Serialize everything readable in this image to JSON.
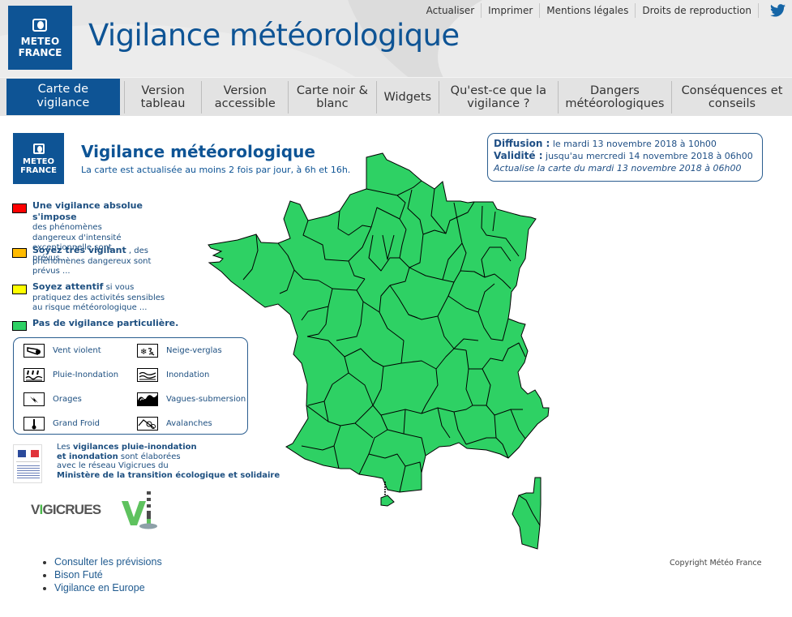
{
  "header": {
    "logo": {
      "line1": "METEO",
      "line2": "FRANCE"
    },
    "title": "Vigilance météorologique",
    "top_links": [
      "Actualiser",
      "Imprimer",
      "Mentions légales",
      "Droits de reproduction"
    ],
    "social_icon": "twitter-icon"
  },
  "nav": {
    "tabs": [
      {
        "label": "Carte de vigilance",
        "active": true
      },
      {
        "label": "Version tableau"
      },
      {
        "label": "Version accessible"
      },
      {
        "label": "Carte noir & blanc"
      },
      {
        "label": "Widgets"
      },
      {
        "label": "Qu'est-ce que la vigilance ?"
      },
      {
        "label": "Dangers météorologiques"
      },
      {
        "label": "Conséquences et conseils"
      }
    ]
  },
  "map_panel": {
    "logo": {
      "line1": "METEO",
      "line2": "FRANCE"
    },
    "title": "Vigilance météorologique",
    "subtitle": "La carte est actualisée au moins 2 fois par jour, à 6h et 16h.",
    "diffusion_label": "Diffusion :",
    "diffusion_value": "le mardi 13 novembre 2018 à 10h00",
    "validite_label": "Validité :",
    "validite_value": "jusqu'au mercredi 14 novembre 2018 à 06h00",
    "actualise": "Actualise la carte du mardi 13 novembre 2018 à 06h00",
    "current_level_color": "#2ed164",
    "departments_state": "all green (Pas de vigilance particulière)"
  },
  "legend": {
    "levels": [
      {
        "color": "#ff0000",
        "bold": "Une vigilance absolue s'impose",
        "text": "des phénomènes dangereux d'intensité exceptionnelle sont prévus..."
      },
      {
        "color": "#ffbb00",
        "bold": "Soyez très vigilant",
        "text": ", des phénomènes dangereux sont prévus ..."
      },
      {
        "color": "#ffff00",
        "bold": "Soyez attentif",
        "text": "si vous pratiquez des activités sensibles au risque météorologique ..."
      },
      {
        "color": "#2ed164",
        "bold": "Pas de vigilance particulière.",
        "text": ""
      }
    ],
    "hazards": [
      {
        "icon": "wind-icon",
        "label": "Vent violent"
      },
      {
        "icon": "snow-ice-icon",
        "label": "Neige-verglas"
      },
      {
        "icon": "rain-flood-icon",
        "label": "Pluie-Inondation"
      },
      {
        "icon": "flood-icon",
        "label": "Inondation"
      },
      {
        "icon": "storm-icon",
        "label": "Orages"
      },
      {
        "icon": "wave-submersion-icon",
        "label": "Vagues-submersion"
      },
      {
        "icon": "thermometer-cold-icon",
        "label": "Grand Froid"
      },
      {
        "icon": "avalanche-icon",
        "label": "Avalanches"
      }
    ]
  },
  "vigicrues": {
    "line1_prefix": "Les ",
    "line1_bold": "vigilances pluie-inondation",
    "line2_bold": "et inondation",
    "line2_rest": " sont élaborées",
    "line3": "avec le réseau Vigicrues du",
    "line4_bold": "Ministère de la transition écologique et solidaire",
    "logo_text_pre": "V",
    "logo_text_i": "I",
    "logo_text_post": "GICRUES"
  },
  "links": [
    "Consulter les prévisions",
    "Bison Futé",
    "Vigilance en Europe"
  ],
  "copyright": "Copyright Météo France"
}
